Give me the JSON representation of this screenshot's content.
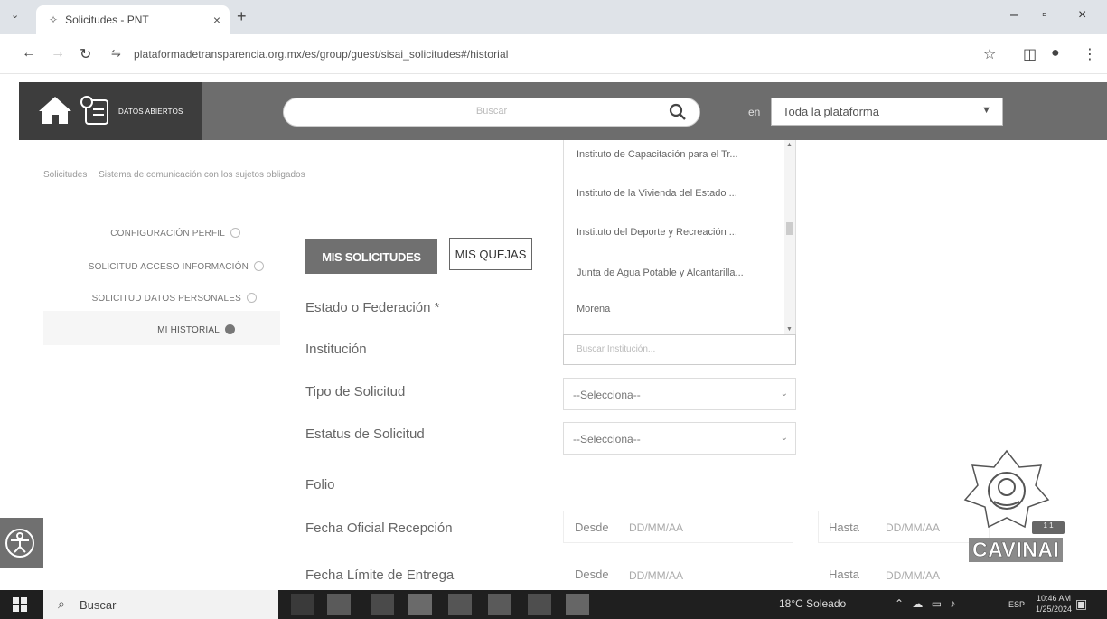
{
  "browser": {
    "tab_title": "Solicitudes - PNT",
    "url": "plataformadetransparencia.org.mx/es/group/guest/sisai_solicitudes#/historial"
  },
  "header": {
    "brand_label": "DATOS ABIERTOS",
    "search_placeholder": "Buscar",
    "en_label": "en",
    "scope_value": "Toda la plataforma"
  },
  "breadcrumbs": {
    "active": "Solicitudes",
    "other": "Sistema de comunicación con los sujetos obligados"
  },
  "sidebar": {
    "items": [
      {
        "label": "CONFIGURACIÓN PERFIL"
      },
      {
        "label": "SOLICITUD ACCESO INFORMACIÓN"
      },
      {
        "label": "SOLICITUD DATOS PERSONALES"
      },
      {
        "label": "MI HISTORIAL"
      }
    ]
  },
  "main": {
    "btn_solicitudes": "MIS SOLICITUDES",
    "btn_quejas": "MIS QUEJAS",
    "labels": {
      "estado": "Estado o Federación *",
      "institucion": "Institución",
      "tipo": "Tipo de Solicitud",
      "estatus": "Estatus de Solicitud",
      "folio": "Folio",
      "fecha_oficial": "Fecha Oficial Recepción",
      "fecha_limite": "Fecha Límite de Entrega"
    },
    "dropdown_items": [
      "Instituto de Capacitación para el Tr...",
      "Instituto de la Vivienda del Estado ...",
      "Instituto del Deporte y Recreación ...",
      "Junta de Agua Potable y Alcantarilla...",
      "Morena"
    ],
    "institucion_placeholder": "Buscar Institución...",
    "tipo_value": "--Selecciona--",
    "estatus_value": "--Selecciona--",
    "desde_label": "Desde",
    "hasta_label": "Hasta",
    "date_placeholder": "DD/MM/AA"
  },
  "widgets": {
    "cavinai": "CAVINAI",
    "cavinai_badge": "1 1"
  },
  "taskbar": {
    "search": "Buscar",
    "weather": "18°C Soleado",
    "lang": "ESP",
    "time": "10:46 AM",
    "date": "1/25/2024"
  },
  "icons": [
    "home-icon",
    "document-icon",
    "search-icon",
    "chevron-down-icon",
    "accessibility-icon",
    "windows-icon"
  ]
}
